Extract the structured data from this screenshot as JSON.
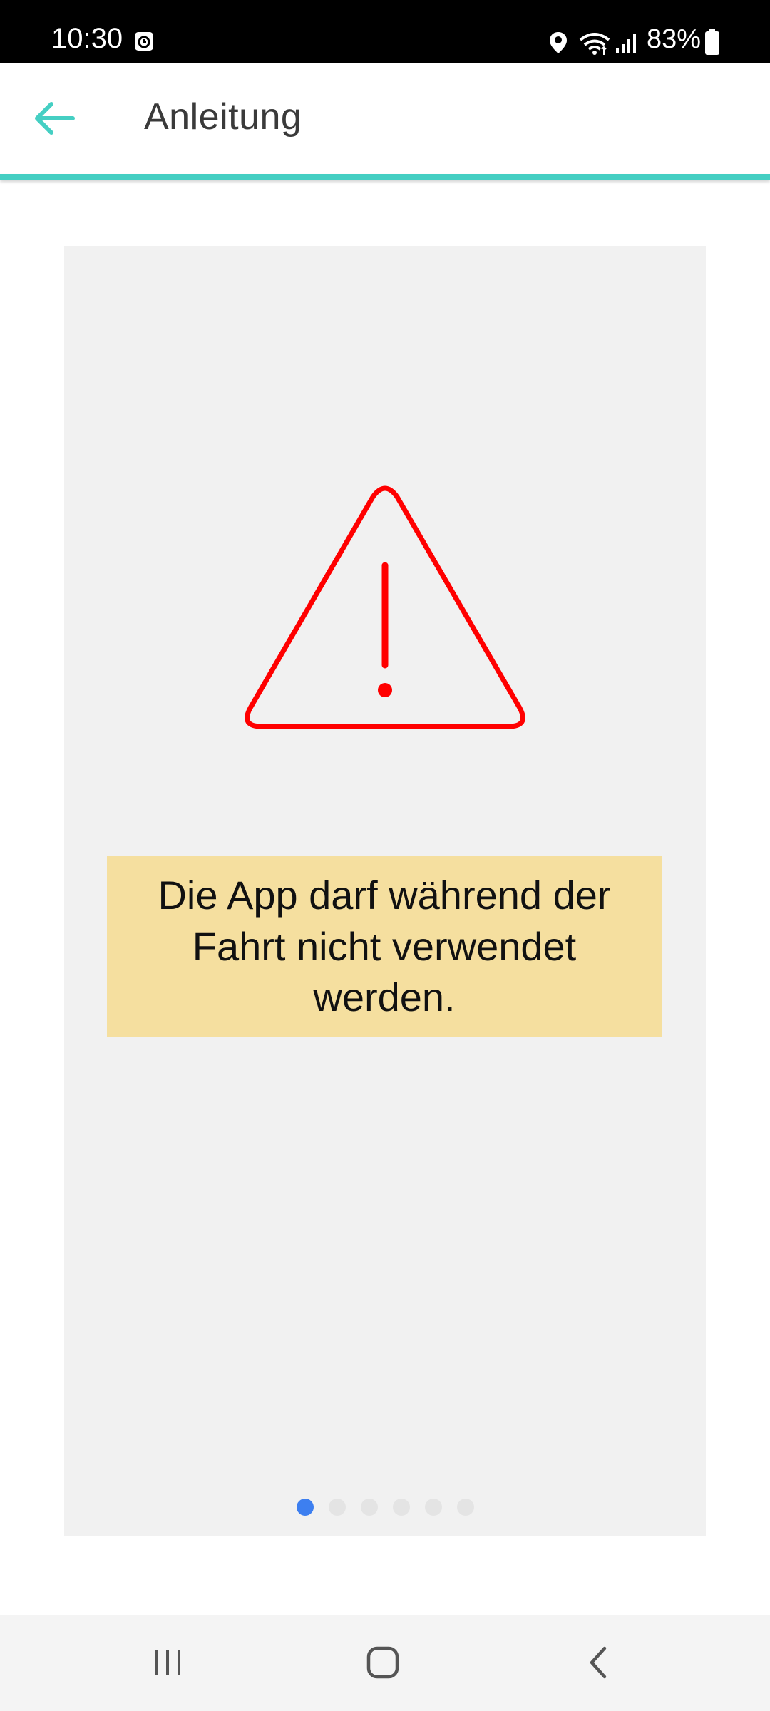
{
  "status_bar": {
    "time": "10:30",
    "battery": "83%",
    "icons": [
      "alarm-icon",
      "location-icon",
      "wifi-icon",
      "signal-icon",
      "battery-icon"
    ]
  },
  "app_bar": {
    "title": "Anleitung",
    "back_icon": "arrow-left-icon"
  },
  "slide": {
    "icon": "warning-triangle-icon",
    "message": "Die App darf während der Fahrt nicht verwendet werden."
  },
  "pager": {
    "count": 6,
    "active_index": 0
  },
  "nav_bar": {
    "icons": [
      "recents-icon",
      "home-icon",
      "back-icon"
    ]
  },
  "colors": {
    "accent": "#45cfc3",
    "warning": "#ff0000",
    "message_background": "#f5df9f",
    "panel_background": "#f1f1f1",
    "active_dot": "#3d7ff0"
  }
}
